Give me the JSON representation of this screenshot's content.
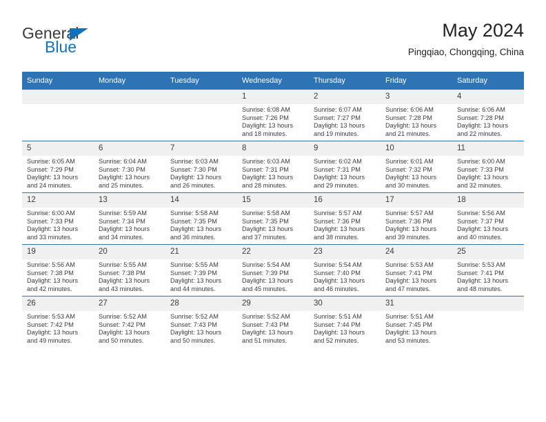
{
  "logo": {
    "word_one": "General",
    "word_two": "Blue",
    "triangle_icon": "blue-triangle-icon",
    "accent_color": "#1172bb"
  },
  "header": {
    "title": "May 2024",
    "subtitle": "Pingqiao, Chongqing, China"
  },
  "theme": {
    "header_blue": "#2e74b5",
    "daynum_band": "#f0f0f0",
    "text": "#3b3b3b"
  },
  "weekday_headers": [
    "Sunday",
    "Monday",
    "Tuesday",
    "Wednesday",
    "Thursday",
    "Friday",
    "Saturday"
  ],
  "weeks": [
    [
      {
        "day": "",
        "sunrise": "",
        "sunset": "",
        "daylight_line1": "",
        "daylight_line2": "",
        "empty": true
      },
      {
        "day": "",
        "sunrise": "",
        "sunset": "",
        "daylight_line1": "",
        "daylight_line2": "",
        "empty": true
      },
      {
        "day": "",
        "sunrise": "",
        "sunset": "",
        "daylight_line1": "",
        "daylight_line2": "",
        "empty": true
      },
      {
        "day": "1",
        "sunrise": "Sunrise: 6:08 AM",
        "sunset": "Sunset: 7:26 PM",
        "daylight_line1": "Daylight: 13 hours",
        "daylight_line2": "and 18 minutes."
      },
      {
        "day": "2",
        "sunrise": "Sunrise: 6:07 AM",
        "sunset": "Sunset: 7:27 PM",
        "daylight_line1": "Daylight: 13 hours",
        "daylight_line2": "and 19 minutes."
      },
      {
        "day": "3",
        "sunrise": "Sunrise: 6:06 AM",
        "sunset": "Sunset: 7:28 PM",
        "daylight_line1": "Daylight: 13 hours",
        "daylight_line2": "and 21 minutes."
      },
      {
        "day": "4",
        "sunrise": "Sunrise: 6:06 AM",
        "sunset": "Sunset: 7:28 PM",
        "daylight_line1": "Daylight: 13 hours",
        "daylight_line2": "and 22 minutes."
      }
    ],
    [
      {
        "day": "5",
        "sunrise": "Sunrise: 6:05 AM",
        "sunset": "Sunset: 7:29 PM",
        "daylight_line1": "Daylight: 13 hours",
        "daylight_line2": "and 24 minutes."
      },
      {
        "day": "6",
        "sunrise": "Sunrise: 6:04 AM",
        "sunset": "Sunset: 7:30 PM",
        "daylight_line1": "Daylight: 13 hours",
        "daylight_line2": "and 25 minutes."
      },
      {
        "day": "7",
        "sunrise": "Sunrise: 6:03 AM",
        "sunset": "Sunset: 7:30 PM",
        "daylight_line1": "Daylight: 13 hours",
        "daylight_line2": "and 26 minutes."
      },
      {
        "day": "8",
        "sunrise": "Sunrise: 6:03 AM",
        "sunset": "Sunset: 7:31 PM",
        "daylight_line1": "Daylight: 13 hours",
        "daylight_line2": "and 28 minutes."
      },
      {
        "day": "9",
        "sunrise": "Sunrise: 6:02 AM",
        "sunset": "Sunset: 7:31 PM",
        "daylight_line1": "Daylight: 13 hours",
        "daylight_line2": "and 29 minutes."
      },
      {
        "day": "10",
        "sunrise": "Sunrise: 6:01 AM",
        "sunset": "Sunset: 7:32 PM",
        "daylight_line1": "Daylight: 13 hours",
        "daylight_line2": "and 30 minutes."
      },
      {
        "day": "11",
        "sunrise": "Sunrise: 6:00 AM",
        "sunset": "Sunset: 7:33 PM",
        "daylight_line1": "Daylight: 13 hours",
        "daylight_line2": "and 32 minutes."
      }
    ],
    [
      {
        "day": "12",
        "sunrise": "Sunrise: 6:00 AM",
        "sunset": "Sunset: 7:33 PM",
        "daylight_line1": "Daylight: 13 hours",
        "daylight_line2": "and 33 minutes."
      },
      {
        "day": "13",
        "sunrise": "Sunrise: 5:59 AM",
        "sunset": "Sunset: 7:34 PM",
        "daylight_line1": "Daylight: 13 hours",
        "daylight_line2": "and 34 minutes."
      },
      {
        "day": "14",
        "sunrise": "Sunrise: 5:58 AM",
        "sunset": "Sunset: 7:35 PM",
        "daylight_line1": "Daylight: 13 hours",
        "daylight_line2": "and 36 minutes."
      },
      {
        "day": "15",
        "sunrise": "Sunrise: 5:58 AM",
        "sunset": "Sunset: 7:35 PM",
        "daylight_line1": "Daylight: 13 hours",
        "daylight_line2": "and 37 minutes."
      },
      {
        "day": "16",
        "sunrise": "Sunrise: 5:57 AM",
        "sunset": "Sunset: 7:36 PM",
        "daylight_line1": "Daylight: 13 hours",
        "daylight_line2": "and 38 minutes."
      },
      {
        "day": "17",
        "sunrise": "Sunrise: 5:57 AM",
        "sunset": "Sunset: 7:36 PM",
        "daylight_line1": "Daylight: 13 hours",
        "daylight_line2": "and 39 minutes."
      },
      {
        "day": "18",
        "sunrise": "Sunrise: 5:56 AM",
        "sunset": "Sunset: 7:37 PM",
        "daylight_line1": "Daylight: 13 hours",
        "daylight_line2": "and 40 minutes."
      }
    ],
    [
      {
        "day": "19",
        "sunrise": "Sunrise: 5:56 AM",
        "sunset": "Sunset: 7:38 PM",
        "daylight_line1": "Daylight: 13 hours",
        "daylight_line2": "and 42 minutes."
      },
      {
        "day": "20",
        "sunrise": "Sunrise: 5:55 AM",
        "sunset": "Sunset: 7:38 PM",
        "daylight_line1": "Daylight: 13 hours",
        "daylight_line2": "and 43 minutes."
      },
      {
        "day": "21",
        "sunrise": "Sunrise: 5:55 AM",
        "sunset": "Sunset: 7:39 PM",
        "daylight_line1": "Daylight: 13 hours",
        "daylight_line2": "and 44 minutes."
      },
      {
        "day": "22",
        "sunrise": "Sunrise: 5:54 AM",
        "sunset": "Sunset: 7:39 PM",
        "daylight_line1": "Daylight: 13 hours",
        "daylight_line2": "and 45 minutes."
      },
      {
        "day": "23",
        "sunrise": "Sunrise: 5:54 AM",
        "sunset": "Sunset: 7:40 PM",
        "daylight_line1": "Daylight: 13 hours",
        "daylight_line2": "and 46 minutes."
      },
      {
        "day": "24",
        "sunrise": "Sunrise: 5:53 AM",
        "sunset": "Sunset: 7:41 PM",
        "daylight_line1": "Daylight: 13 hours",
        "daylight_line2": "and 47 minutes."
      },
      {
        "day": "25",
        "sunrise": "Sunrise: 5:53 AM",
        "sunset": "Sunset: 7:41 PM",
        "daylight_line1": "Daylight: 13 hours",
        "daylight_line2": "and 48 minutes."
      }
    ],
    [
      {
        "day": "26",
        "sunrise": "Sunrise: 5:53 AM",
        "sunset": "Sunset: 7:42 PM",
        "daylight_line1": "Daylight: 13 hours",
        "daylight_line2": "and 49 minutes."
      },
      {
        "day": "27",
        "sunrise": "Sunrise: 5:52 AM",
        "sunset": "Sunset: 7:42 PM",
        "daylight_line1": "Daylight: 13 hours",
        "daylight_line2": "and 50 minutes."
      },
      {
        "day": "28",
        "sunrise": "Sunrise: 5:52 AM",
        "sunset": "Sunset: 7:43 PM",
        "daylight_line1": "Daylight: 13 hours",
        "daylight_line2": "and 50 minutes."
      },
      {
        "day": "29",
        "sunrise": "Sunrise: 5:52 AM",
        "sunset": "Sunset: 7:43 PM",
        "daylight_line1": "Daylight: 13 hours",
        "daylight_line2": "and 51 minutes."
      },
      {
        "day": "30",
        "sunrise": "Sunrise: 5:51 AM",
        "sunset": "Sunset: 7:44 PM",
        "daylight_line1": "Daylight: 13 hours",
        "daylight_line2": "and 52 minutes."
      },
      {
        "day": "31",
        "sunrise": "Sunrise: 5:51 AM",
        "sunset": "Sunset: 7:45 PM",
        "daylight_line1": "Daylight: 13 hours",
        "daylight_line2": "and 53 minutes."
      },
      {
        "day": "",
        "sunrise": "",
        "sunset": "",
        "daylight_line1": "",
        "daylight_line2": "",
        "empty": true
      }
    ]
  ]
}
